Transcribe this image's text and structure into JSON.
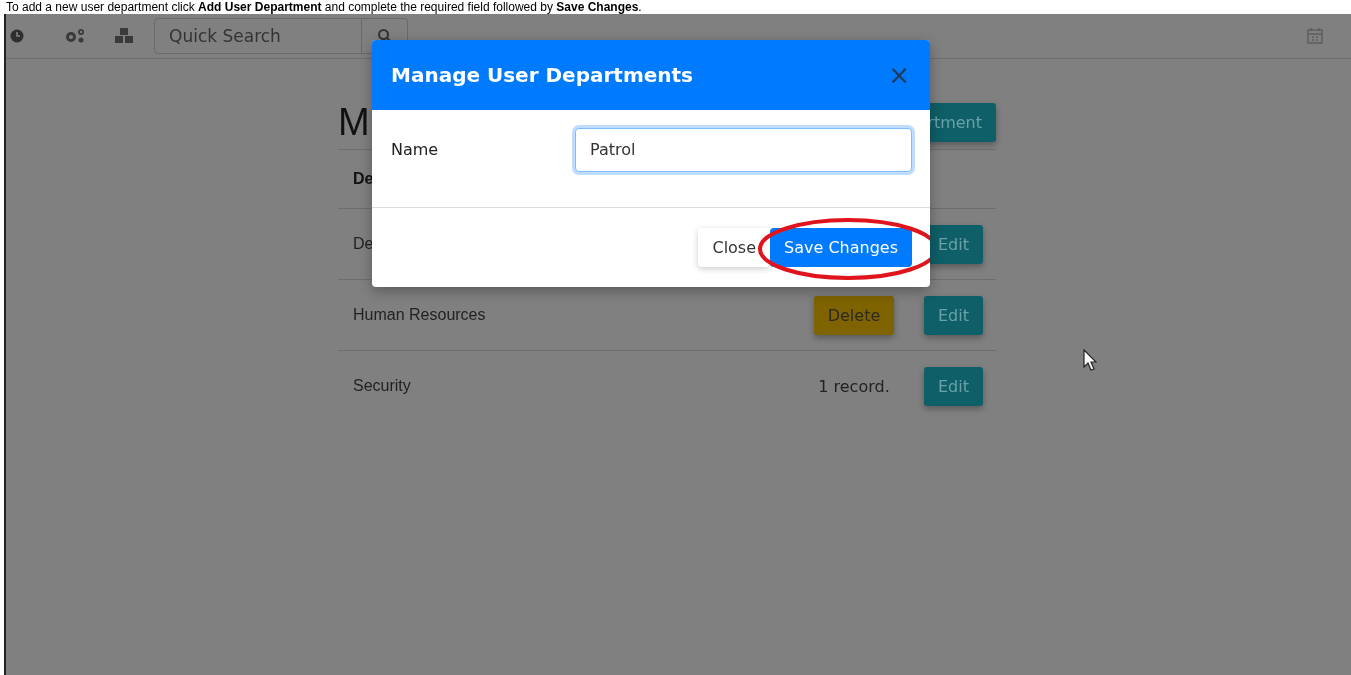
{
  "caption": "To add a new user department click **Add User Department** and complete the required field followed by **Save Changes**.",
  "toolbar": {
    "search": {
      "placeholder": "Quick Search"
    }
  },
  "page": {
    "heading": "M",
    "add_button": "rtment",
    "table": {
      "header": "De",
      "rows": [
        {
          "name": "De",
          "edit": "Edit"
        },
        {
          "name": "Human Resources",
          "delete": "Delete",
          "edit": "Edit"
        },
        {
          "name": "Security",
          "count": "1 record.",
          "edit": "Edit"
        }
      ]
    }
  },
  "modal": {
    "title": "Manage User Departments",
    "close_glyph": "×",
    "field": {
      "label": "Name",
      "value": "Patrol"
    },
    "buttons": [
      {
        "label": "Close",
        "kind": "secondary",
        "highlighted": false
      },
      {
        "label": "Save Changes",
        "kind": "primary",
        "highlighted": true
      }
    ]
  }
}
